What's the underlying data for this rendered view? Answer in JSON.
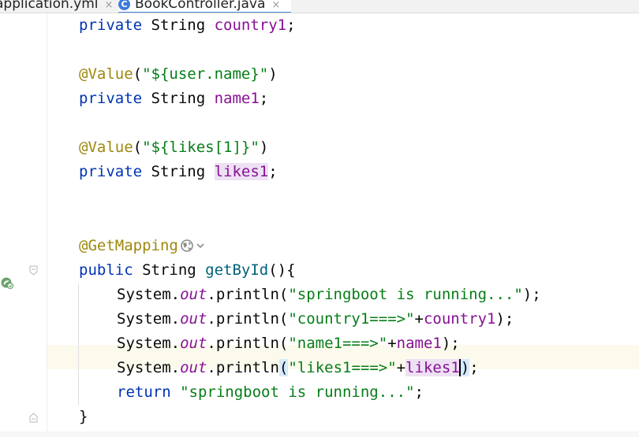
{
  "tabs": {
    "tab1": {
      "label": "application.yml",
      "close": "×"
    },
    "tab2": {
      "label": "BookController.java",
      "close": "×",
      "icon": "java-class-icon"
    }
  },
  "code": {
    "line1": {
      "t0": "private",
      "t1": " String ",
      "t2": "country1",
      "t3": ";"
    },
    "line3": {
      "t0": "@Value",
      "t1": "(",
      "t2": "\"${user.name}\"",
      "t3": ")"
    },
    "line4": {
      "t0": "private",
      "t1": " String ",
      "t2": "name1",
      "t3": ";"
    },
    "line6": {
      "t0": "@Value",
      "t1": "(",
      "t2": "\"${likes[1]}\"",
      "t3": ")"
    },
    "line7": {
      "t0": "private",
      "t1": " String ",
      "t2": "likes1",
      "t3": ";"
    },
    "line10": {
      "t0": "@GetMapping"
    },
    "line11": {
      "t0": "public",
      "t1": " String ",
      "t2": "getById",
      "t3": "(){"
    },
    "line12": {
      "t0": "System.",
      "t1": "out",
      "t2": ".println(",
      "t3": "\"springboot is running...\"",
      "t4": ");"
    },
    "line13": {
      "t0": "System.",
      "t1": "out",
      "t2": ".println(",
      "t3": "\"country1===>\"",
      "t4": "+",
      "t5": "country1",
      "t6": ");"
    },
    "line14": {
      "t0": "System.",
      "t1": "out",
      "t2": ".println(",
      "t3": "\"name1===>\"",
      "t4": "+",
      "t5": "name1",
      "t6": ");"
    },
    "line15": {
      "t0": "System.",
      "t1": "out",
      "t2": ".println",
      "t3": "(",
      "t4": "\"likes1===>\"",
      "t5": "+",
      "t6": "likes1",
      "t7": ")",
      "t8": ";"
    },
    "line16": {
      "t0": "return",
      "t1": " ",
      "t2": "\"springboot is running...\"",
      "t3": ";"
    },
    "line17": {
      "t0": "}"
    }
  },
  "colors": {
    "keyword": "#0033b3",
    "annotation": "#9e880d",
    "string": "#067d17",
    "field": "#871094",
    "method": "#00627a",
    "current_line": "#fcfaed",
    "tab_underline": "#4a7fd6"
  },
  "icons": {
    "web_icon": "globe-icon",
    "dropdown": "chevron-down-icon",
    "gutter": "spring-bean-run-icon"
  }
}
